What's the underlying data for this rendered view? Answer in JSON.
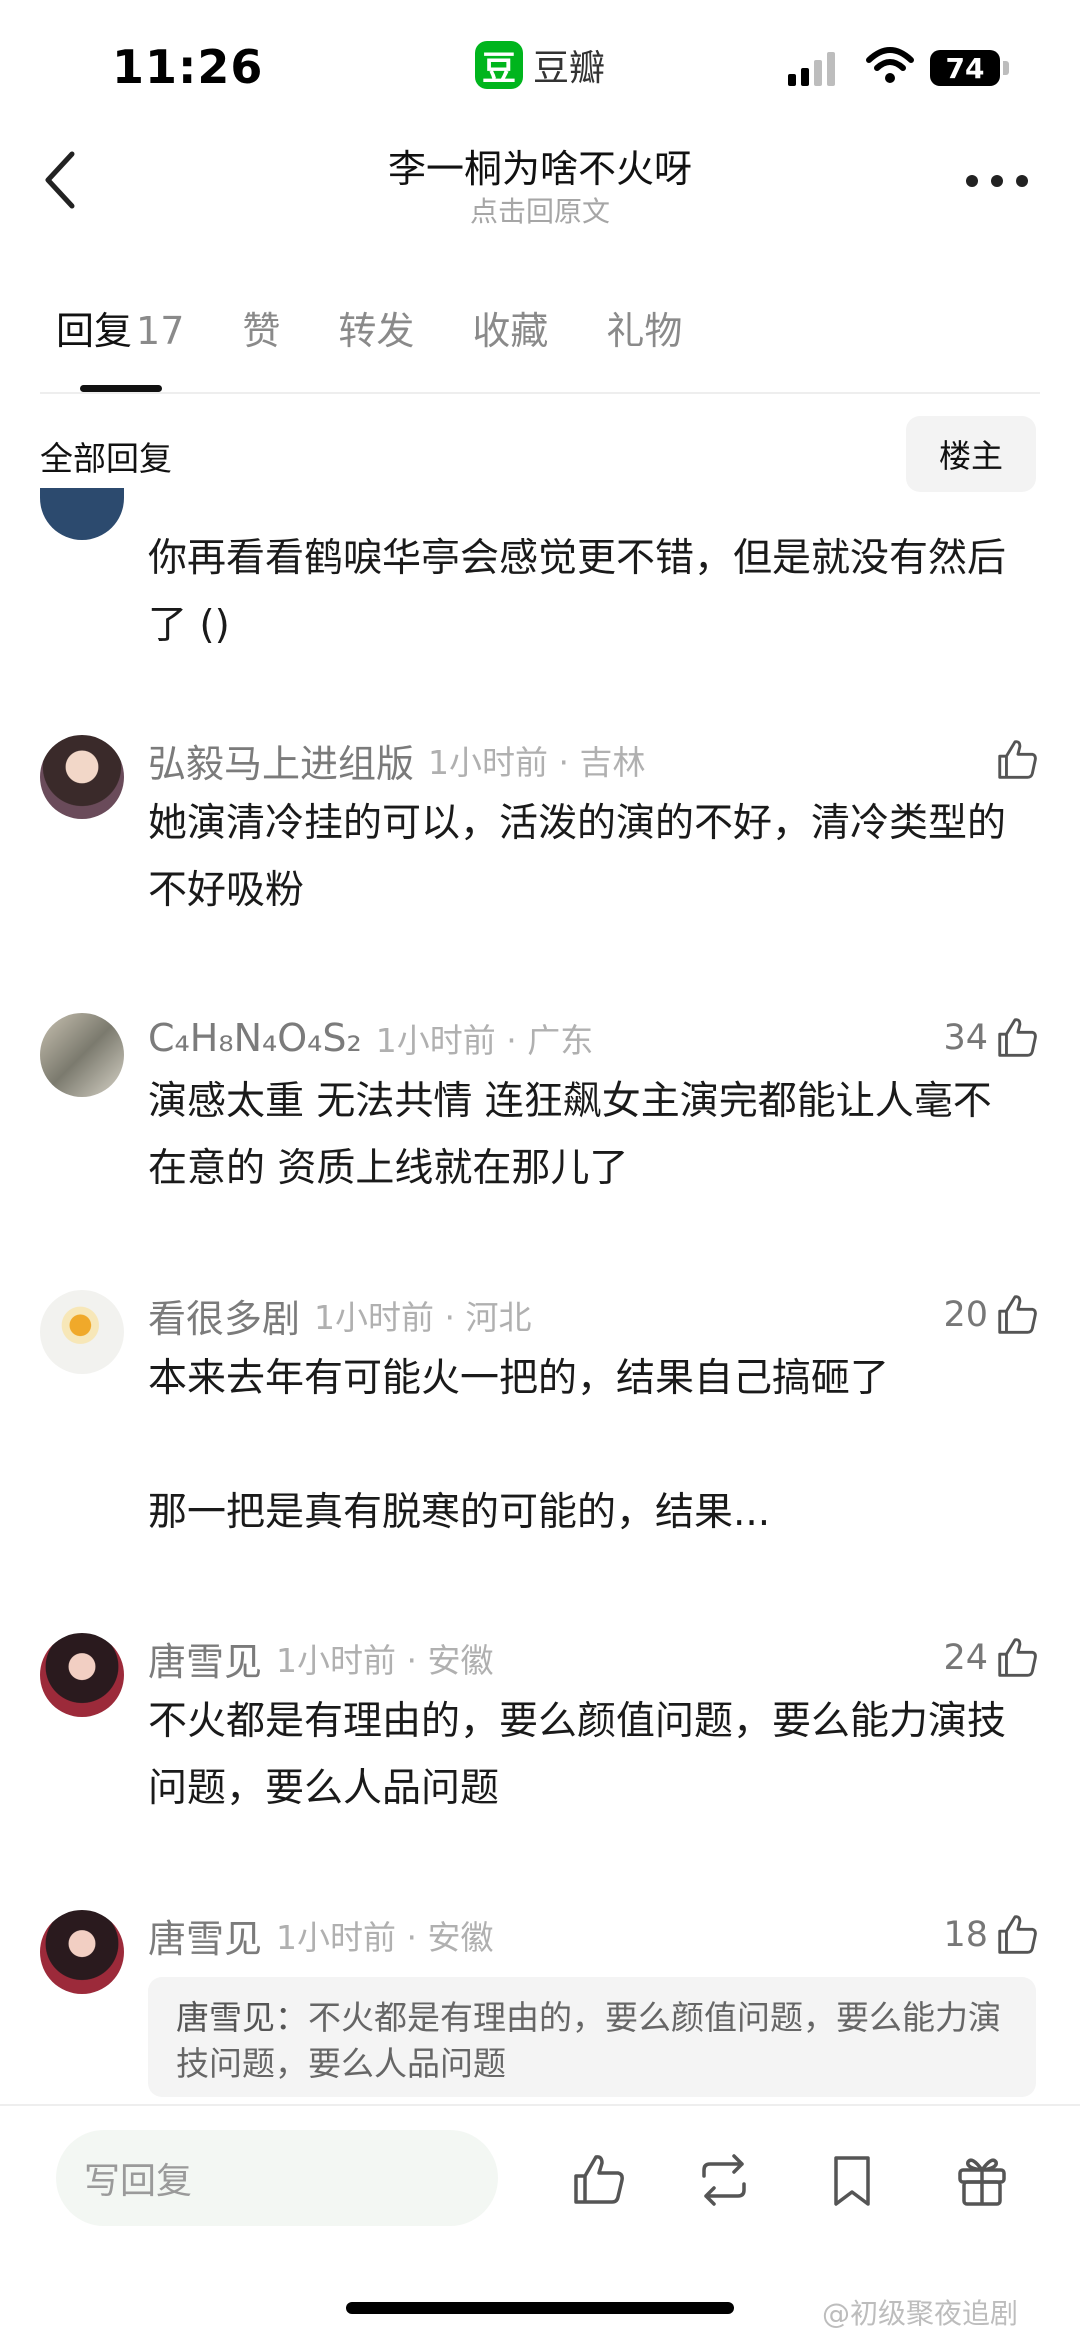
{
  "status_bar": {
    "time": "11:26",
    "app_logo_char": "豆",
    "app_name": "豆瓣",
    "battery": "74"
  },
  "header": {
    "title": "李一桐为啥不火呀",
    "subtitle": "点击回原文"
  },
  "tabs": [
    {
      "label": "回复",
      "count": "17",
      "active": true
    },
    {
      "label": "赞",
      "count": ""
    },
    {
      "label": "转发",
      "count": ""
    },
    {
      "label": "收藏",
      "count": ""
    },
    {
      "label": "礼物",
      "count": ""
    }
  ],
  "section": {
    "title": "全部回复",
    "filter_label": "楼主"
  },
  "comments": [
    {
      "username": "",
      "time_location": "",
      "likes": "",
      "content": "你再看看鹤唳华亭会感觉更不错，但是就没有然后了 ()"
    },
    {
      "username": "弘毅马上进组版",
      "time_location": "1小时前 · 吉林",
      "likes": "",
      "content": "她演清冷挂的可以，活泼的演的不好，清冷类型的不好吸粉"
    },
    {
      "username": "C₄H₈N₄O₄S₂",
      "time_location": "1小时前 · 广东",
      "likes": "34",
      "content": "演感太重 无法共情 连狂飙女主演完都能让人毫不在意的 资质上线就在那儿了"
    },
    {
      "username": "看很多剧",
      "time_location": "1小时前 · 河北",
      "likes": "20",
      "content": "本来去年有可能火一把的，结果自己搞砸了\n\n那一把是真有脱寒的可能的，结果..."
    },
    {
      "username": "唐雪见",
      "time_location": "1小时前 · 安徽",
      "likes": "24",
      "content": "不火都是有理由的，要么颜值问题，要么能力演技问题，要么人品问题"
    },
    {
      "username": "唐雪见",
      "time_location": "1小时前 · 安徽",
      "likes": "18",
      "content": "",
      "quote_author": "唐雪见：",
      "quote_text": "不火都是有理由的，要么颜值问题，要么能力演技问题，要么人品问题"
    }
  ],
  "bottom_bar": {
    "reply_placeholder": "写回复"
  },
  "watermark": "@初级聚夜追剧",
  "icons": {
    "back": "chevron-left-icon",
    "more": "ellipsis-icon",
    "like": "thumbs-up-icon",
    "repost": "repost-icon",
    "bookmark": "bookmark-icon",
    "gift": "gift-icon"
  },
  "colors": {
    "brand_green": "#00b51d",
    "text_primary": "#1a1a1a",
    "text_secondary": "#7b7b7b"
  }
}
